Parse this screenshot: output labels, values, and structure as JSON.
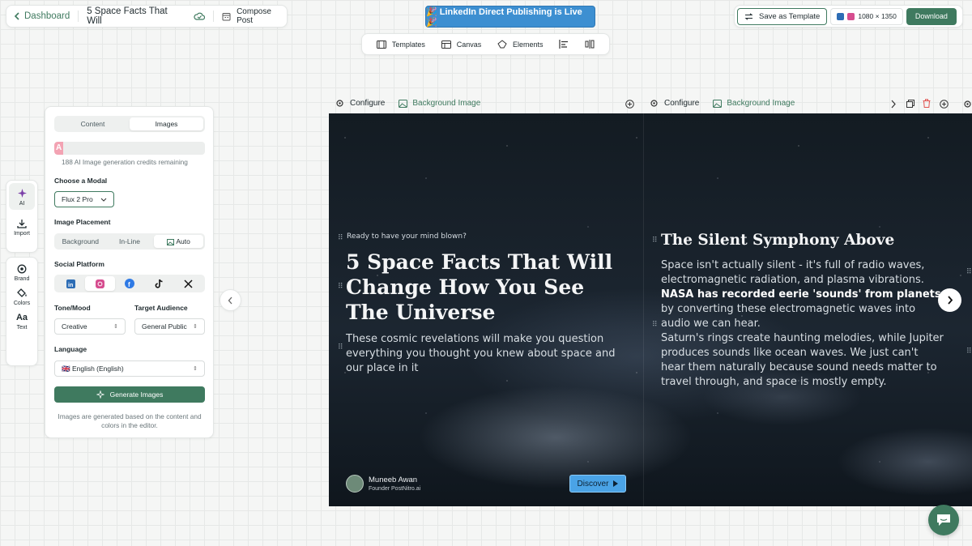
{
  "header": {
    "back_label": "Dashboard",
    "doc_title": "5 Space Facts That Will",
    "compose_label": "Compose Post"
  },
  "banner": {
    "text": "🎉 LinkedIn Direct Publishing is Live 🎉"
  },
  "actions": {
    "save_template": "Save as Template",
    "size": "1080 × 1350",
    "download": "Download"
  },
  "toolbar": {
    "templates": "Templates",
    "canvas": "Canvas",
    "elements": "Elements"
  },
  "rail": {
    "ai": "AI",
    "import": "Import",
    "brand": "Brand",
    "colors": "Colors",
    "text": "Text"
  },
  "panel": {
    "tabs": [
      "Content",
      "Images"
    ],
    "active_tab": "Images",
    "credits_letter": "A",
    "credits_text": "188 AI Image generation credits remaining",
    "model_label": "Choose a Modal",
    "model_value": "Flux 2 Pro",
    "placement_label": "Image Placement",
    "placement_options": [
      "Background",
      "In-Line",
      "Auto"
    ],
    "placement_selected": "Auto",
    "social_label": "Social Platform",
    "social_platforms": [
      "linkedin",
      "instagram",
      "facebook",
      "tiktok",
      "x"
    ],
    "social_selected": "instagram",
    "tone_label": "Tone/Mood",
    "tone_value": "Creative",
    "audience_label": "Target Audience",
    "audience_value": "General Public",
    "language_label": "Language",
    "language_value": "🇬🇧 English (English)",
    "generate_label": "Generate Images",
    "footnote": "Images are generated based on the content and colors in the editor."
  },
  "canvas": {
    "configure": "Configure",
    "background_image": "Background Image",
    "slide1": {
      "hook": "Ready to have your mind blown?",
      "headline": "5 Space Facts That Will Change How You See The Universe",
      "subtitle": "These cosmic revelations will make you question everything you thought you knew about space and our place in it",
      "author_name": "Muneeb Awan",
      "author_role": "Founder PostNitro.ai",
      "cta": "Discover"
    },
    "slide2": {
      "heading": "The Silent Symphony Above",
      "p1_a": "Space isn't actually silent - it's full of radio waves, electromagnetic radiation, and plasma vibrations. ",
      "p1_bold": "NASA has recorded eerie 'sounds' from planets",
      "p1_b": " by converting these electromagnetic waves into audio we can hear.",
      "p2": "Saturn's rings create haunting melodies, while Jupiter produces sounds like ocean waves. We just can't hear them naturally because sound needs matter to travel through, and space is mostly empty."
    }
  },
  "colors": {
    "accent": "#3f7a5f",
    "banner": "#3d8fd1",
    "cta": "#4aa3e6",
    "credits": "#f3a3b3"
  }
}
